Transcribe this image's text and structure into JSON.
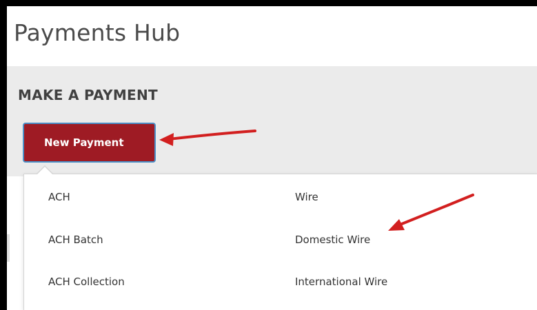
{
  "page": {
    "title": "Payments Hub"
  },
  "make_payment": {
    "section_title": "MAKE A PAYMENT",
    "new_payment_label": "New Payment"
  },
  "menu": {
    "ach_column": [
      "ACH",
      "ACH Batch",
      "ACH Collection"
    ],
    "wire_column": [
      "Wire",
      "Domestic Wire",
      "International Wire"
    ]
  },
  "annotations": {
    "arrow_color": "#d21f1f"
  },
  "colors": {
    "brand_red": "#9e1b24",
    "focus_blue": "#4a90c8",
    "panel_gray": "#ebebeb"
  }
}
